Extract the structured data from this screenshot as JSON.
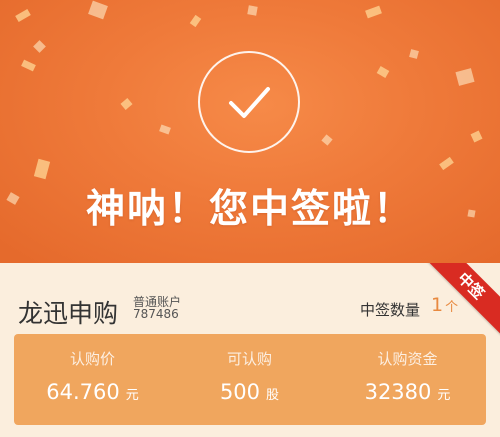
{
  "hero": {
    "headline": "神呐！您中签啦！",
    "icon": "checkmark-circle-icon"
  },
  "card": {
    "ribbon": "中签",
    "stock_name": "龙迅申购",
    "account_type": "普通账户",
    "account_number": "787486",
    "won_label": "中签数量",
    "won_count": "1",
    "won_unit": "个",
    "stats": [
      {
        "label": "认购价",
        "value": "64.760",
        "unit": "元"
      },
      {
        "label": "可认购",
        "value": "500",
        "unit": "股"
      },
      {
        "label": "认购资金",
        "value": "32380",
        "unit": "元"
      }
    ]
  },
  "colors": {
    "hero": "#ef7a3a",
    "ribbon": "#d92b22",
    "stats_panel": "#f0a65e",
    "accent": "#e8893f",
    "card_bg": "#fbeedd"
  }
}
